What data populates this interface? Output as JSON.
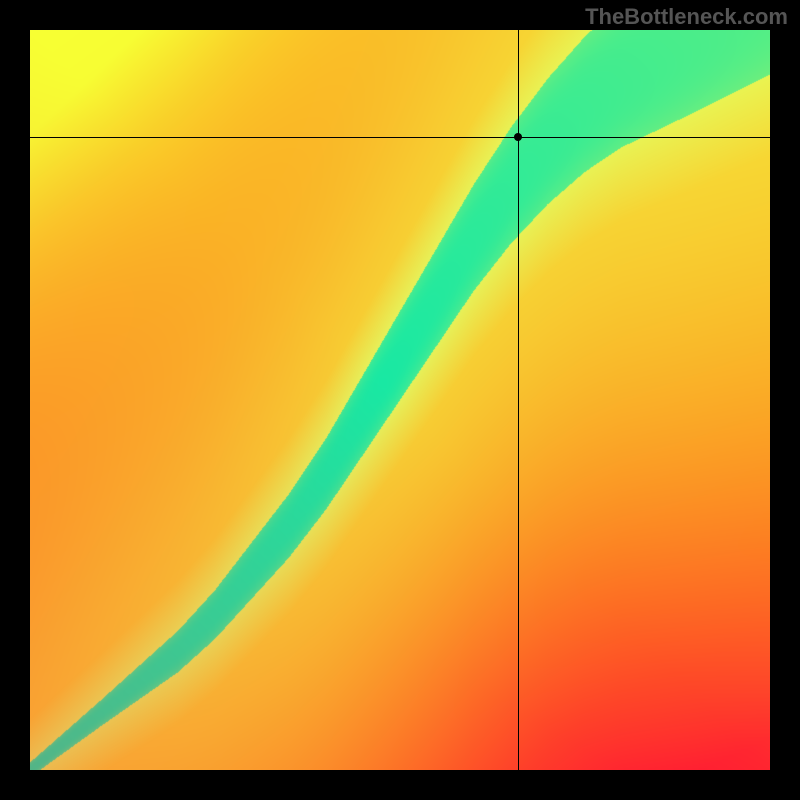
{
  "watermark": "TheBottleneck.com",
  "chart_data": {
    "type": "heatmap",
    "title": "",
    "xlabel": "",
    "ylabel": "",
    "xlim": [
      0,
      1
    ],
    "ylim": [
      0,
      1
    ],
    "crosshair": {
      "x": 0.66,
      "y": 0.856
    },
    "point": {
      "x": 0.66,
      "y": 0.856
    },
    "ridge_path": [
      {
        "x": 0.0,
        "y": 0.0
      },
      {
        "x": 0.05,
        "y": 0.04
      },
      {
        "x": 0.1,
        "y": 0.08
      },
      {
        "x": 0.15,
        "y": 0.12
      },
      {
        "x": 0.2,
        "y": 0.16
      },
      {
        "x": 0.25,
        "y": 0.21
      },
      {
        "x": 0.3,
        "y": 0.27
      },
      {
        "x": 0.35,
        "y": 0.33
      },
      {
        "x": 0.4,
        "y": 0.4
      },
      {
        "x": 0.45,
        "y": 0.48
      },
      {
        "x": 0.5,
        "y": 0.56
      },
      {
        "x": 0.55,
        "y": 0.64
      },
      {
        "x": 0.6,
        "y": 0.72
      },
      {
        "x": 0.65,
        "y": 0.79
      },
      {
        "x": 0.7,
        "y": 0.85
      },
      {
        "x": 0.75,
        "y": 0.9
      },
      {
        "x": 0.8,
        "y": 0.94
      },
      {
        "x": 0.85,
        "y": 0.97
      },
      {
        "x": 0.9,
        "y": 1.0
      },
      {
        "x": 0.95,
        "y": 1.03
      },
      {
        "x": 1.0,
        "y": 1.06
      }
    ],
    "ridge_width": [
      {
        "x": 0.0,
        "w": 0.01
      },
      {
        "x": 0.1,
        "w": 0.018
      },
      {
        "x": 0.2,
        "w": 0.028
      },
      {
        "x": 0.3,
        "w": 0.038
      },
      {
        "x": 0.4,
        "w": 0.048
      },
      {
        "x": 0.5,
        "w": 0.06
      },
      {
        "x": 0.6,
        "w": 0.072
      },
      {
        "x": 0.7,
        "w": 0.085
      },
      {
        "x": 0.8,
        "w": 0.098
      },
      {
        "x": 0.9,
        "w": 0.11
      },
      {
        "x": 1.0,
        "w": 0.12
      }
    ],
    "color_stops": {
      "ridge": "#19e8a3",
      "near": "#e6f05a",
      "mid": "#f7cc33",
      "far": "#fd8d16",
      "edge_bl": "#ff1a33",
      "edge_tr": "#f7ff33"
    },
    "description": "Heatmap ranging red→orange→yellow→green along a curved diagonal ridge; crosshair marker near top indicates selected point on the ridge boundary."
  }
}
